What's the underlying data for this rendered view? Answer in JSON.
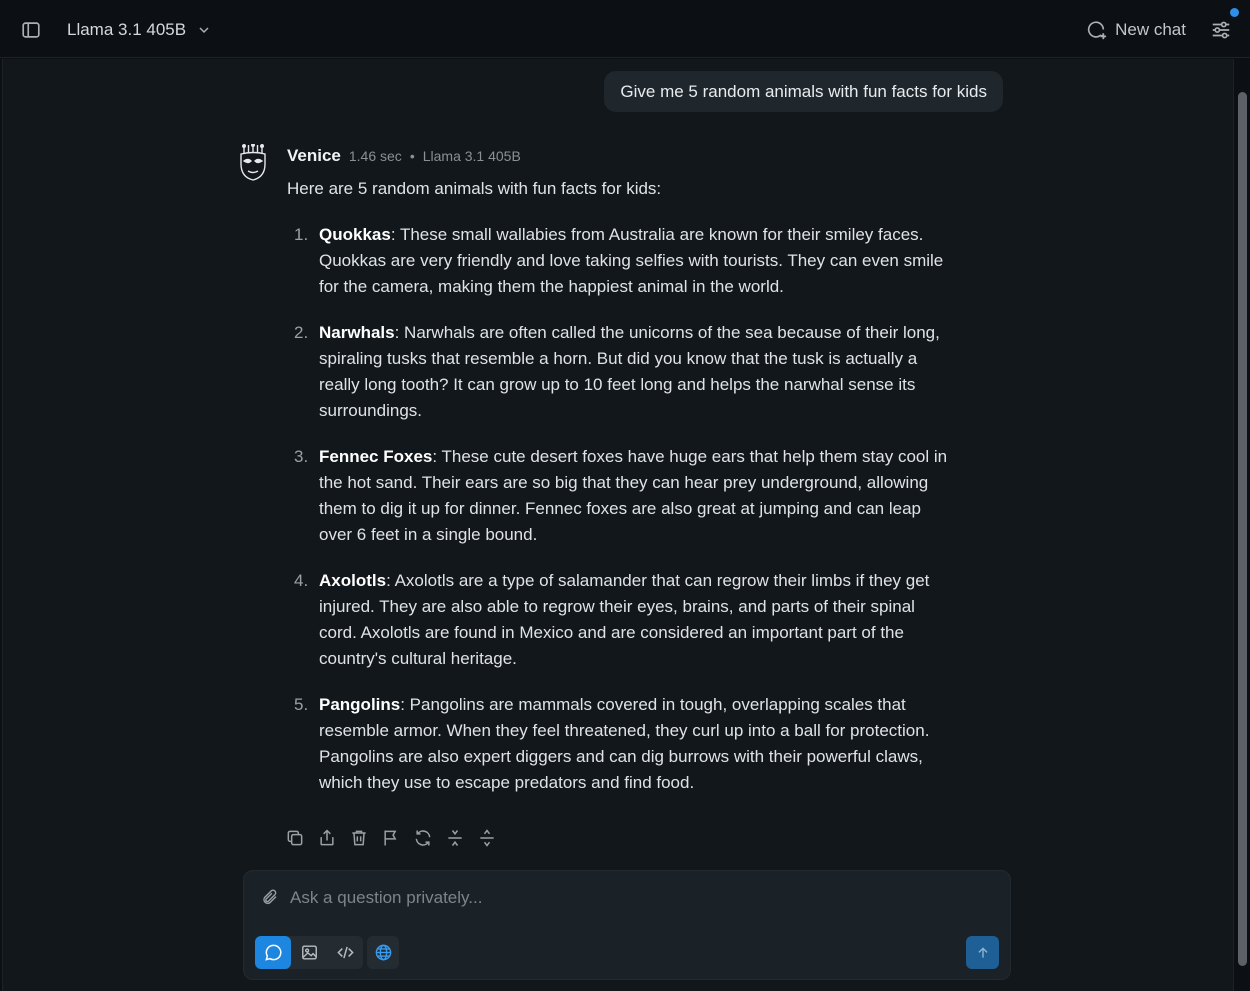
{
  "topbar": {
    "model_name": "Llama 3.1 405B",
    "new_chat_label": "New chat"
  },
  "conversation": {
    "user_message": "Give me 5 random animals with fun facts for kids",
    "assistant": {
      "name": "Venice",
      "response_time": "1.46 sec",
      "separator": "•",
      "model": "Llama 3.1 405B",
      "intro": "Here are 5 random animals with fun facts for kids:",
      "facts": [
        {
          "num": "1.",
          "name": "Quokkas",
          "text": ": These small wallabies from Australia are known for their smiley faces. Quokkas are very friendly and love taking selfies with tourists. They can even smile for the camera, making them the happiest animal in the world."
        },
        {
          "num": "2.",
          "name": "Narwhals",
          "text": ": Narwhals are often called the unicorns of the sea because of their long, spiraling tusks that resemble a horn. But did you know that the tusk is actually a really long tooth? It can grow up to 10 feet long and helps the narwhal sense its surroundings."
        },
        {
          "num": "3.",
          "name": "Fennec Foxes",
          "text": ": These cute desert foxes have huge ears that help them stay cool in the hot sand. Their ears are so big that they can hear prey underground, allowing them to dig it up for dinner. Fennec foxes are also great at jumping and can leap over 6 feet in a single bound."
        },
        {
          "num": "4.",
          "name": "Axolotls",
          "text": ": Axolotls are a type of salamander that can regrow their limbs if they get injured. They are also able to regrow their eyes, brains, and parts of their spinal cord. Axolotls are found in Mexico and are considered an important part of the country's cultural heritage."
        },
        {
          "num": "5.",
          "name": "Pangolins",
          "text": ": Pangolins are mammals covered in tough, overlapping scales that resemble armor. When they feel threatened, they curl up into a ball for protection. Pangolins are also expert diggers and can dig burrows with their powerful claws, which they use to escape predators and find food."
        }
      ]
    }
  },
  "message_actions": [
    "copy-icon",
    "share-icon",
    "trash-icon",
    "flag-icon",
    "regenerate-icon",
    "collapse-icon",
    "expand-icon"
  ],
  "composer": {
    "placeholder": "Ask a question privately...",
    "active_mode": "chat"
  },
  "colors": {
    "accent": "#1d86e0",
    "notification_dot": "#2d8fea",
    "background": "#12171b"
  }
}
